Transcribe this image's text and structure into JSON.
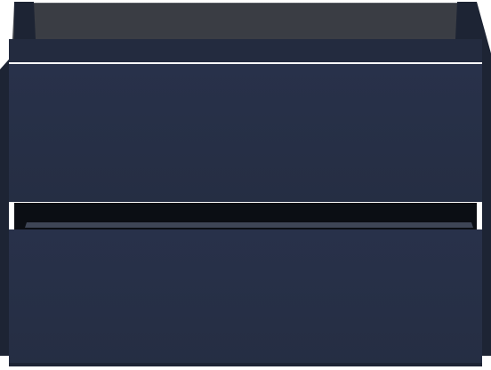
{
  "product": {
    "type": "wall-hung vanity cabinet",
    "drawer_count": 2,
    "handle_style": "handleless finger-pull groove",
    "view": "front, open top"
  },
  "colors": {
    "background": "#ffffff",
    "body": "#232b3f",
    "body_shadow": "#1d2434",
    "drawer_front": "#252e43",
    "drawer_front_light": "#28314a",
    "inner_top": "#5a5e66",
    "inner_back": "#3a3d44",
    "groove": "#0b0e14",
    "groove_edge": "#3e4556"
  }
}
